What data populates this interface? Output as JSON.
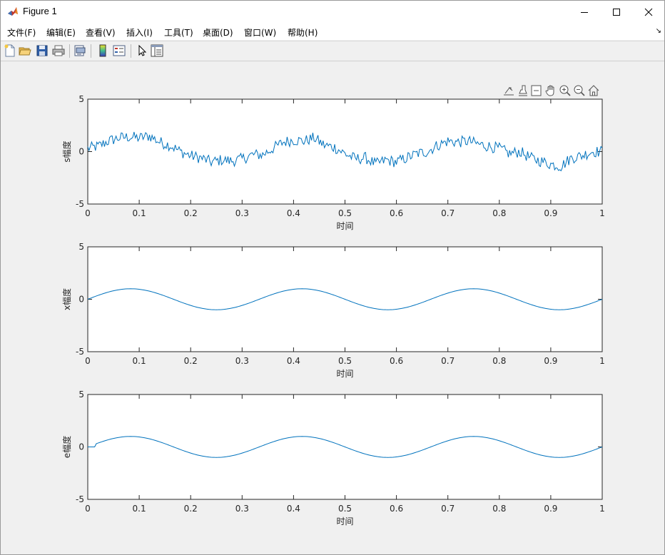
{
  "window": {
    "title": "Figure 1",
    "min_label": "—",
    "max_label": "☐",
    "close_label": "✕"
  },
  "menu": {
    "items": [
      "文件(F)",
      "编辑(E)",
      "查看(V)",
      "插入(I)",
      "工具(T)",
      "桌面(D)",
      "窗口(W)",
      "帮助(H)"
    ],
    "corner": "↘"
  },
  "toolbar": {
    "icons": [
      "new-figure-icon",
      "open-file-icon",
      "save-icon",
      "print-icon",
      "print-preview-icon",
      "colorbar-icon",
      "legend-icon",
      "pointer-icon",
      "property-inspector-icon"
    ]
  },
  "axes_toolbar": {
    "icons": [
      "export-icon",
      "brush-icon",
      "datatip-icon",
      "pan-icon",
      "zoom-in-icon",
      "zoom-out-icon",
      "home-icon"
    ]
  },
  "colors": {
    "line": "#0072bd",
    "axes_bg": "#ffffff",
    "figure_bg": "#f0f0f0",
    "axis": "#262626"
  },
  "chart_data": [
    {
      "type": "line",
      "title": "",
      "xlabel": "时间",
      "ylabel": "s幅度",
      "xlim": [
        0,
        1
      ],
      "ylim": [
        -5,
        5
      ],
      "xticks": [
        "0",
        "0.1",
        "0.2",
        "0.3",
        "0.4",
        "0.5",
        "0.6",
        "0.7",
        "0.8",
        "0.9",
        "1"
      ],
      "yticks": [
        "-5",
        "0",
        "5"
      ],
      "grid": false,
      "series": [
        {
          "x": [
            0,
            0.02,
            0.04,
            0.06,
            0.08,
            0.1,
            0.12,
            0.14,
            0.16,
            0.18,
            0.2,
            0.22,
            0.24,
            0.26,
            0.28,
            0.3,
            0.32,
            0.34,
            0.36,
            0.38,
            0.4,
            0.42,
            0.44,
            0.46,
            0.48,
            0.5,
            0.52,
            0.54,
            0.56,
            0.58,
            0.6,
            0.62,
            0.64,
            0.66,
            0.68,
            0.7,
            0.72,
            0.74,
            0.76,
            0.78,
            0.8,
            0.82,
            0.84,
            0.86,
            0.88,
            0.9,
            0.92,
            0.94,
            0.96,
            0.98,
            1.0
          ],
          "y": [
            0.3,
            0.5,
            1.0,
            1.3,
            1.4,
            1.3,
            1.5,
            0.9,
            0.6,
            0.0,
            -0.4,
            -0.6,
            -1.0,
            -0.8,
            -0.9,
            -0.7,
            -0.3,
            -0.3,
            0.3,
            0.9,
            1.1,
            1.0,
            1.3,
            0.6,
            0.4,
            -0.2,
            -0.7,
            -0.6,
            -1.2,
            -0.8,
            -1.0,
            -0.6,
            -0.2,
            0.0,
            0.6,
            1.0,
            0.9,
            1.0,
            0.7,
            0.5,
            0.3,
            -0.2,
            0.0,
            -0.6,
            -0.9,
            -1.2,
            -1.4,
            -0.6,
            -0.4,
            0.0,
            0.0
          ]
        }
      ]
    },
    {
      "type": "line",
      "title": "",
      "xlabel": "时间",
      "ylabel": "x幅度",
      "xlim": [
        0,
        1
      ],
      "ylim": [
        -5,
        5
      ],
      "xticks": [
        "0",
        "0.1",
        "0.2",
        "0.3",
        "0.4",
        "0.5",
        "0.6",
        "0.7",
        "0.8",
        "0.9",
        "1"
      ],
      "yticks": [
        "-5",
        "0",
        "5"
      ],
      "grid": false,
      "series": [
        {
          "x": [
            0,
            0.0833,
            0.1667,
            0.25,
            0.3333,
            0.4167,
            0.5,
            0.5833,
            0.6667,
            0.75,
            0.8333,
            0.9167,
            1.0
          ],
          "y": [
            0,
            1.0,
            0.5,
            -1.0,
            0.0,
            1.0,
            0.0,
            -1.0,
            0.0,
            1.0,
            0.0,
            -1.0,
            0.0
          ]
        }
      ]
    },
    {
      "type": "line",
      "title": "",
      "xlabel": "时间",
      "ylabel": "e幅度",
      "xlim": [
        0,
        1
      ],
      "ylim": [
        -5,
        5
      ],
      "xticks": [
        "0",
        "0.1",
        "0.2",
        "0.3",
        "0.4",
        "0.5",
        "0.6",
        "0.7",
        "0.8",
        "0.9",
        "1"
      ],
      "yticks": [
        "-5",
        "0",
        "5"
      ],
      "grid": false,
      "series": [
        {
          "x": [
            0,
            0.015,
            0.02,
            0.0833,
            0.1667,
            0.25,
            0.3333,
            0.4167,
            0.5,
            0.5833,
            0.6667,
            0.75,
            0.8333,
            0.9167,
            1.0
          ],
          "y": [
            0,
            0,
            0.4,
            1.0,
            0.5,
            -1.0,
            0.0,
            1.0,
            0.0,
            -1.0,
            0.0,
            1.0,
            0.0,
            -1.0,
            0.0
          ]
        }
      ]
    }
  ]
}
